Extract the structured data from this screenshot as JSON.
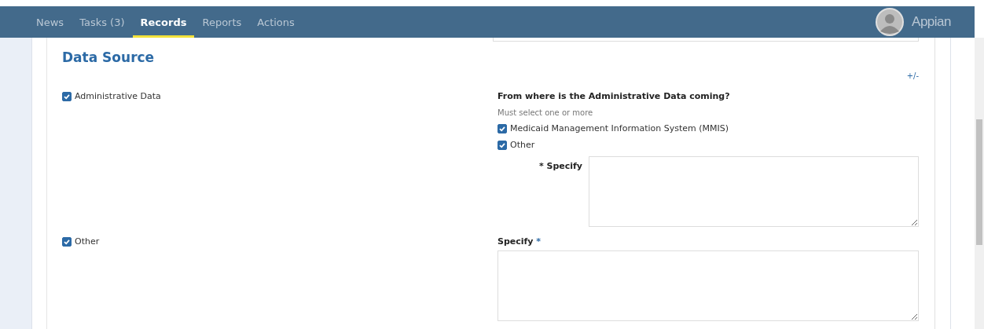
{
  "nav": {
    "tabs": [
      {
        "label": "News",
        "selected": false
      },
      {
        "label": "Tasks (3)",
        "selected": false
      },
      {
        "label": "Records",
        "selected": true
      },
      {
        "label": "Reports",
        "selected": false
      },
      {
        "label": "Actions",
        "selected": false
      }
    ],
    "brand": "Appian"
  },
  "section": {
    "title": "Data Source",
    "toggle": "+/-"
  },
  "rows": [
    {
      "source": {
        "label": "Administrative Data",
        "checked": true
      },
      "question": "From where is the Administrative Data coming?",
      "hint": "Must select one or more",
      "options": [
        {
          "label": "Medicaid Management Information System (MMIS)",
          "checked": true
        },
        {
          "label": "Other",
          "checked": true
        }
      ],
      "field": {
        "label": "Specify",
        "marker": "*",
        "kind": "inline"
      }
    },
    {
      "source": {
        "label": "Other",
        "checked": true
      },
      "field": {
        "label": "Specify",
        "marker": "*",
        "kind": "stacked"
      }
    }
  ]
}
